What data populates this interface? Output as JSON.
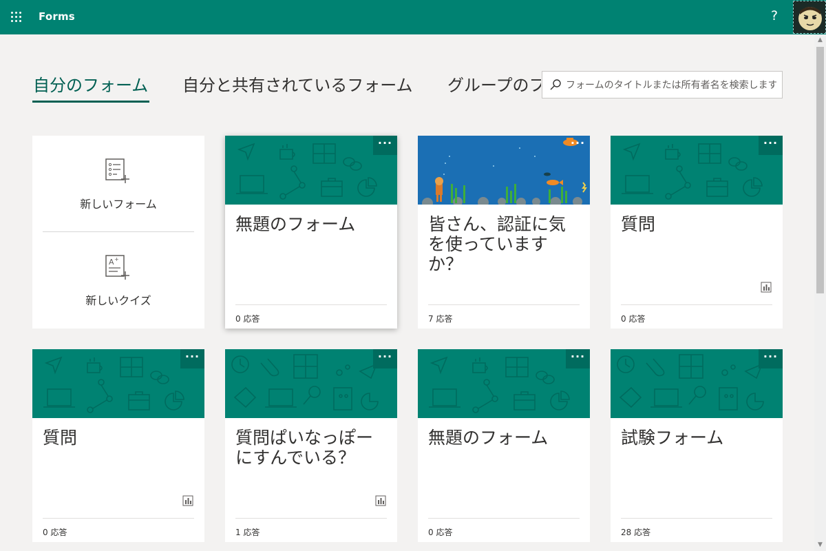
{
  "header": {
    "app_title": "Forms",
    "help_label": "?",
    "icons": [
      "waffle-icon",
      "help-icon",
      "avatar"
    ]
  },
  "tabs": [
    {
      "label": "自分のフォーム",
      "active": true
    },
    {
      "label": "自分と共有されているフォーム",
      "active": false
    },
    {
      "label": "グループのフォーム",
      "active": false
    }
  ],
  "search": {
    "placeholder": "フォームのタイトルまたは所有者名を検索します"
  },
  "new_items": [
    {
      "label": "新しいフォーム",
      "icon": "new-form-icon"
    },
    {
      "label": "新しいクイズ",
      "icon": "new-quiz-icon"
    }
  ],
  "forms": [
    {
      "title": "無題のフォーム",
      "responses": "0 応答",
      "banner": "default-pattern",
      "has_stats": false
    },
    {
      "title": "皆さん、認証に気を使っていますか？",
      "responses": "7 応答",
      "banner": "underwater-scene",
      "has_stats": false
    },
    {
      "title": "質問",
      "responses": "0 応答",
      "banner": "default-pattern",
      "has_stats": true
    },
    {
      "title": "質問",
      "responses": "0 応答",
      "banner": "default-pattern",
      "has_stats": true
    },
    {
      "title": "質問ぱいなっぽーにすんでいる？",
      "responses": "1 応答",
      "banner": "quiz-pattern",
      "has_stats": true
    },
    {
      "title": "無題のフォーム",
      "responses": "0 応答",
      "banner": "default-pattern",
      "has_stats": false
    },
    {
      "title": "試験フォーム",
      "responses": "28 応答",
      "banner": "quiz-pattern",
      "has_stats": false
    }
  ],
  "more_label": "···",
  "colors": {
    "brand": "#008272",
    "tab_active": "#005f52",
    "page_bg": "#f3f2f1"
  }
}
